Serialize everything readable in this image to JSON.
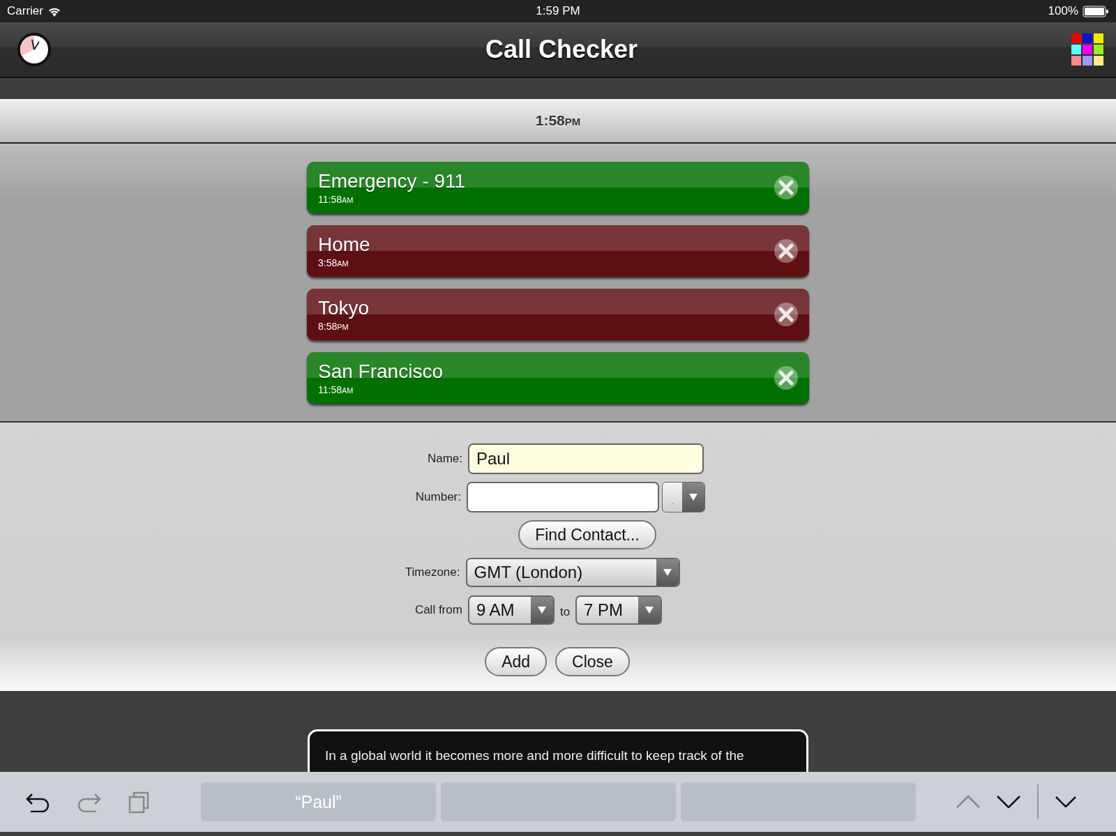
{
  "status_bar": {
    "carrier": "Carrier",
    "time": "1:59 PM",
    "battery": "100%"
  },
  "header": {
    "title": "Call Checker"
  },
  "current_time": {
    "time": "1:58",
    "period": "PM"
  },
  "calls": [
    {
      "name": "Emergency - 911",
      "time": "11:58",
      "period": "AM",
      "color": "#007000"
    },
    {
      "name": "Home",
      "time": "3:58",
      "period": "AM",
      "color": "#5e0f12"
    },
    {
      "name": "Tokyo",
      "time": "8:58",
      "period": "PM",
      "color": "#5e0f12"
    },
    {
      "name": "San Francisco",
      "time": "11:58",
      "period": "AM",
      "color": "#007000"
    }
  ],
  "form": {
    "name_label": "Name:",
    "name_value": "Paul",
    "number_label": "Number:",
    "number_type": ".",
    "find_button": "Find Contact...",
    "timezone_label": "Timezone:",
    "timezone": "GMT (London)",
    "call_from_label": "Call from",
    "from": "9 AM",
    "to_label": "to",
    "to": "7 PM",
    "buttons": [
      "Add",
      "Close"
    ]
  },
  "description": "In a global world it becomes more and more difficult to keep track of the",
  "keyboard_bar": {
    "suggestions": [
      "“Paul”"
    ]
  }
}
